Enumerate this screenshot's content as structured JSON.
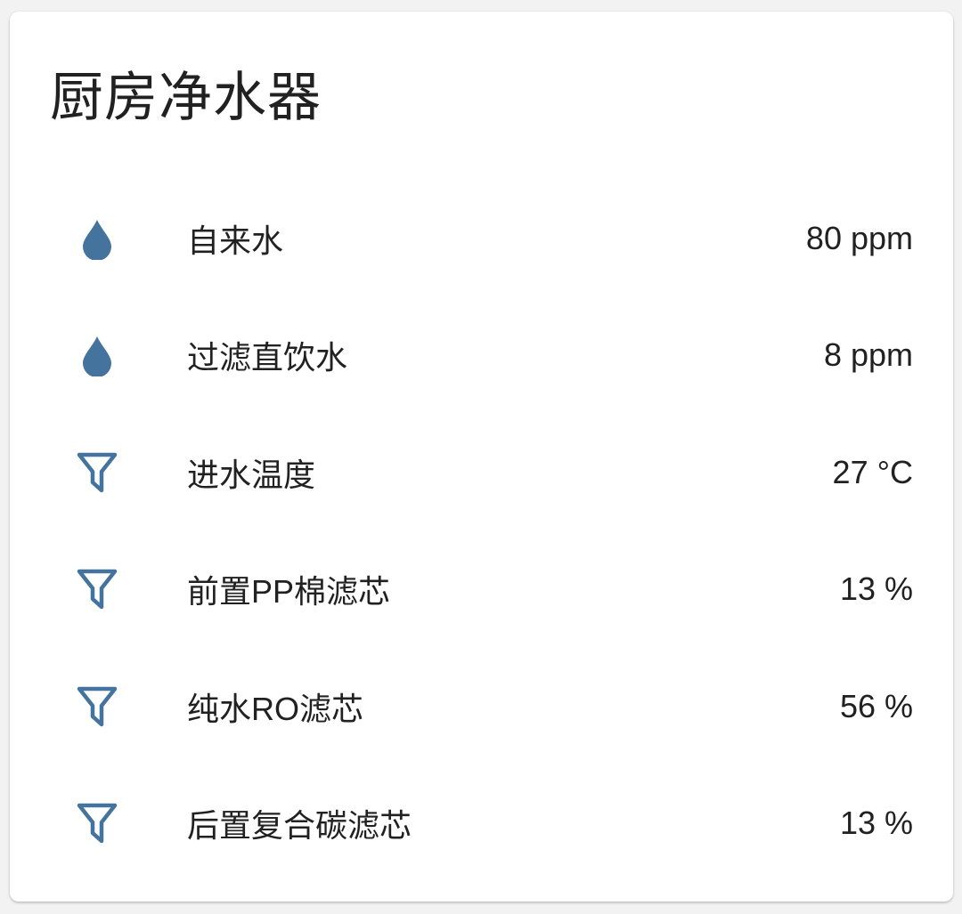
{
  "card": {
    "title": "厨房净水器",
    "icon_color": "#44739e",
    "rows": [
      {
        "icon": "water-drop-icon",
        "name": "自来水",
        "value": "80 ppm"
      },
      {
        "icon": "water-drop-icon",
        "name": "过滤直饮水",
        "value": "8 ppm"
      },
      {
        "icon": "filter-icon",
        "name": "进水温度",
        "value": "27 °C"
      },
      {
        "icon": "filter-icon",
        "name": "前置PP棉滤芯",
        "value": "13 %"
      },
      {
        "icon": "filter-icon",
        "name": "纯水RO滤芯",
        "value": "56 %"
      },
      {
        "icon": "filter-icon",
        "name": "后置复合碳滤芯",
        "value": "13 %"
      }
    ]
  }
}
